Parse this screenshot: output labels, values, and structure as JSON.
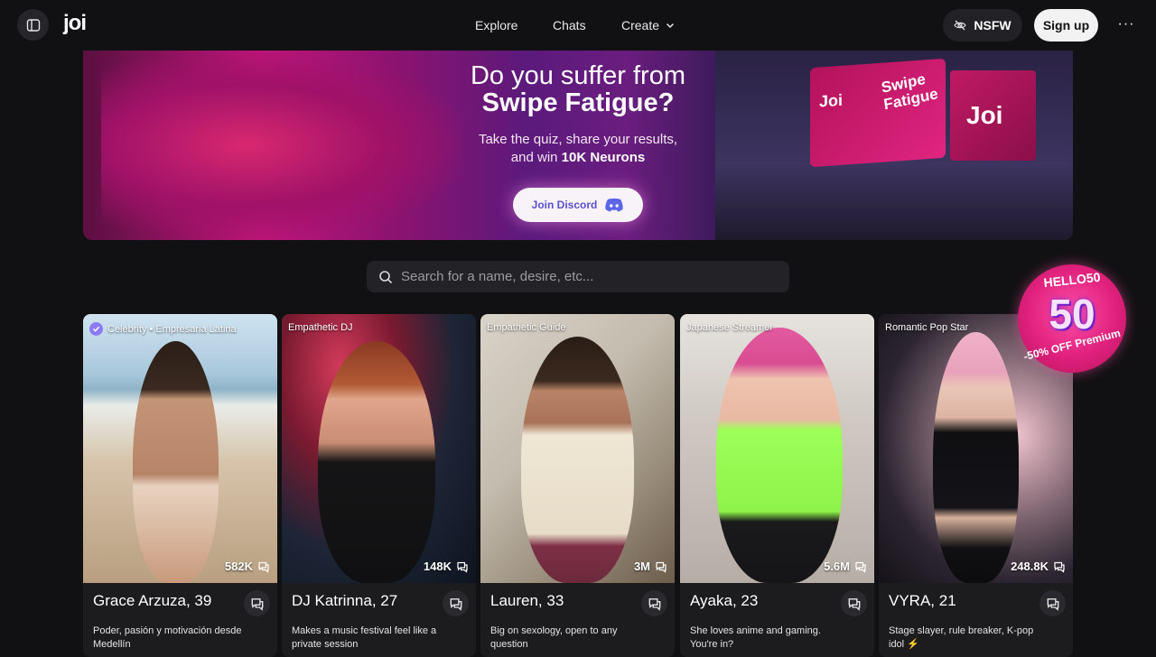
{
  "header": {
    "logo": "joi",
    "nav": {
      "explore": "Explore",
      "chats": "Chats",
      "create": "Create"
    },
    "nsfw_label": "NSFW",
    "signup_label": "Sign up",
    "more_label": "···"
  },
  "banner": {
    "title_line1": "Do you suffer from",
    "title_line2": "Swipe Fatigue?",
    "subtitle_line1": "Take the quiz, share your results,",
    "subtitle_line2_prefix": "and win ",
    "subtitle_line2_bold": "10K Neurons",
    "button_label": "Join Discord",
    "billboard_logo": "Joi",
    "billboard_text_line1": "Swipe",
    "billboard_text_line2": "Fatigue",
    "billboard2_logo": "Joi"
  },
  "search": {
    "placeholder": "Search for a name, desire, etc..."
  },
  "promo": {
    "code": "HELLO50",
    "number": "50",
    "text": "-50% OFF Premium"
  },
  "cards": [
    {
      "tag": "Celebrity • Empresaria Latina",
      "verified": true,
      "count": "582K",
      "name": "Grace Arzuza, 39",
      "desc": "Poder, pasión y motivación desde Medellín"
    },
    {
      "tag": "Empathetic DJ",
      "verified": false,
      "count": "148K",
      "name": "DJ Katrinna, 27",
      "desc": "Makes a music festival feel like a private session"
    },
    {
      "tag": "Empathetic Guide",
      "verified": false,
      "count": "3M",
      "name": "Lauren, 33",
      "desc": "Big on sexology, open to any question"
    },
    {
      "tag": "Japanese Streamer",
      "verified": false,
      "count": "5.6M",
      "name": "Ayaka, 23",
      "desc": "She loves anime and gaming. You're in?"
    },
    {
      "tag": "Romantic Pop Star",
      "verified": false,
      "count": "248.8K",
      "name": "VYRA, 21",
      "desc": "Stage slayer, rule breaker, K-pop idol ⚡"
    }
  ]
}
